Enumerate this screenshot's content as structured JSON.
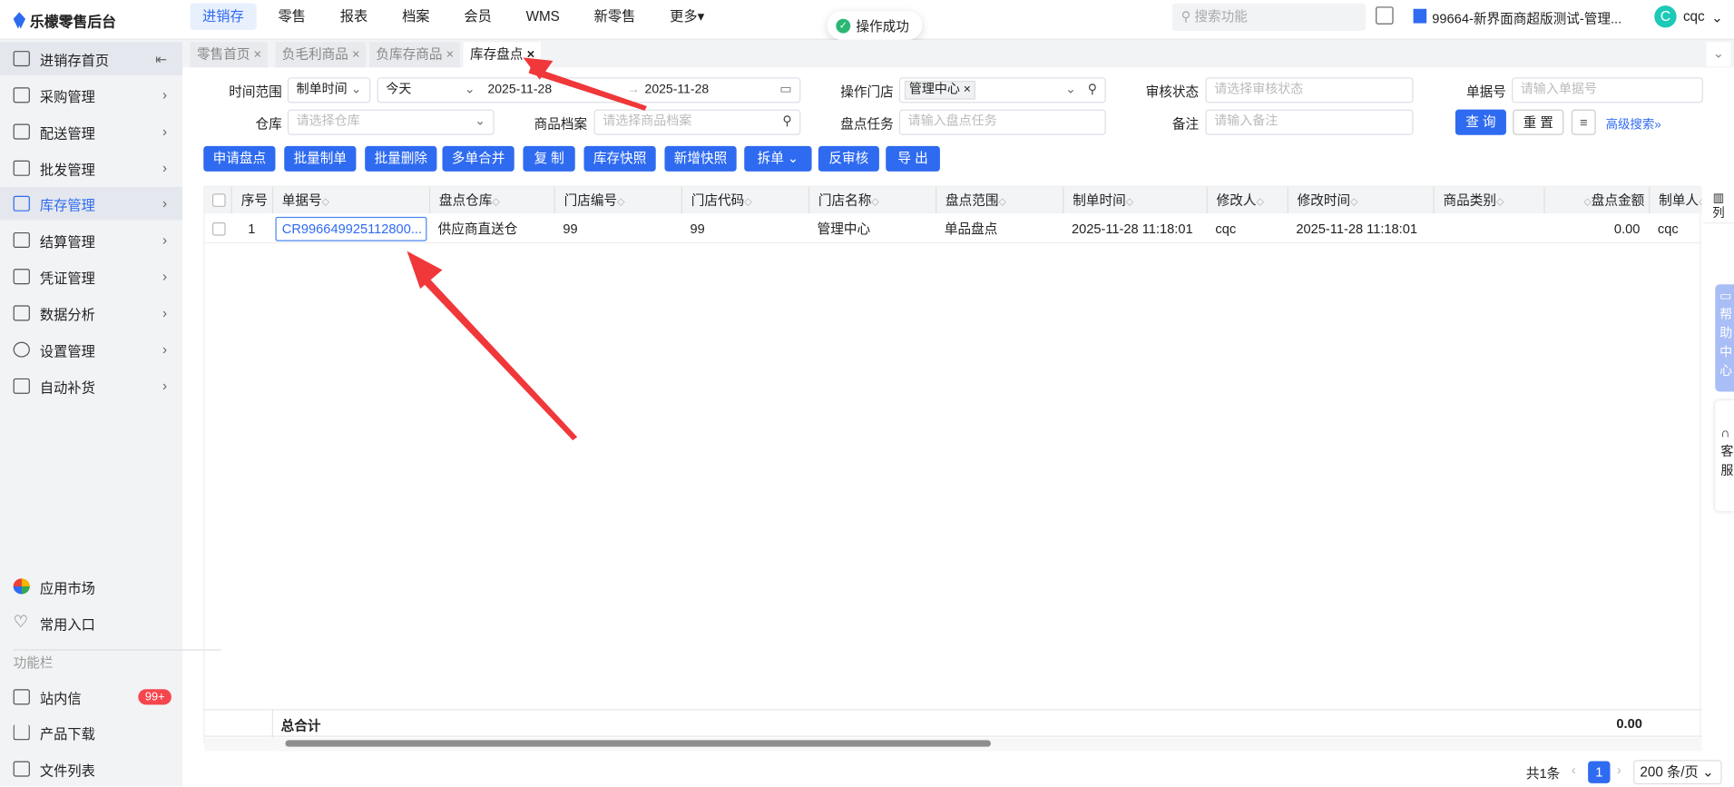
{
  "app": {
    "name": "乐檬零售后台"
  },
  "nav": [
    "进销存",
    "零售",
    "报表",
    "档案",
    "会员",
    "WMS",
    "新零售",
    "更多▾"
  ],
  "toast": "操作成功",
  "global_search": {
    "placeholder": "搜索功能"
  },
  "store_name": "99664-新界面商超版测试-管理...",
  "user": {
    "initial": "C",
    "name": "cqc"
  },
  "sidebar": {
    "items": [
      {
        "label": "进销存首页"
      },
      {
        "label": "采购管理"
      },
      {
        "label": "配送管理"
      },
      {
        "label": "批发管理"
      },
      {
        "label": "库存管理"
      },
      {
        "label": "结算管理"
      },
      {
        "label": "凭证管理"
      },
      {
        "label": "数据分析"
      },
      {
        "label": "设置管理"
      },
      {
        "label": "自动补货"
      }
    ],
    "bottom": [
      {
        "label": "应用市场"
      },
      {
        "label": "常用入口"
      }
    ],
    "section": "功能栏",
    "tools": [
      {
        "label": "站内信",
        "badge": "99+"
      },
      {
        "label": "产品下载"
      },
      {
        "label": "文件列表"
      }
    ]
  },
  "tabs": [
    {
      "label": "零售首页"
    },
    {
      "label": "负毛利商品"
    },
    {
      "label": "负库存商品"
    },
    {
      "label": "库存盘点"
    }
  ],
  "filters": {
    "time_range": {
      "label": "时间范围",
      "type": "制单时间",
      "preset": "今天",
      "start": "2025-11-28",
      "end": "2025-11-28"
    },
    "store": {
      "label": "操作门店",
      "tag": "管理中心"
    },
    "audit": {
      "label": "审核状态",
      "placeholder": "请选择审核状态"
    },
    "doc_no": {
      "label": "单据号",
      "placeholder": "请输入单据号"
    },
    "warehouse": {
      "label": "仓库",
      "placeholder": "请选择仓库"
    },
    "product": {
      "label": "商品档案",
      "placeholder": "请选择商品档案"
    },
    "task": {
      "label": "盘点任务",
      "placeholder": "请输入盘点任务"
    },
    "remark": {
      "label": "备注",
      "placeholder": "请输入备注"
    },
    "query": "查 询",
    "reset": "重 置",
    "advanced": "高级搜索"
  },
  "actions": [
    "申请盘点",
    "批量制单",
    "批量删除",
    "多单合并",
    "复 制",
    "库存快照",
    "新增快照",
    "拆单",
    "反审核",
    "导 出"
  ],
  "table": {
    "columns": [
      "序号",
      "单据号",
      "盘点仓库",
      "门店编号",
      "门店代码",
      "门店名称",
      "盘点范围",
      "制单时间",
      "修改人",
      "修改时间",
      "商品类别",
      "盘点金额",
      "制单人"
    ],
    "rows": [
      [
        "1",
        "CR996649925112800...",
        "供应商直送仓",
        "99",
        "99",
        "管理中心",
        "单品盘点",
        "2025-11-28 11:18:01",
        "cqc",
        "2025-11-28 11:18:01",
        "",
        "0.00",
        "cqc"
      ]
    ],
    "total_label": "总合计",
    "total_amount": "0.00",
    "column_setting": "列"
  },
  "right_rail": {
    "help": "帮助中心",
    "service": "客服"
  },
  "pagination": {
    "total": "共1条",
    "page": "1",
    "page_size": "200 条/页"
  }
}
